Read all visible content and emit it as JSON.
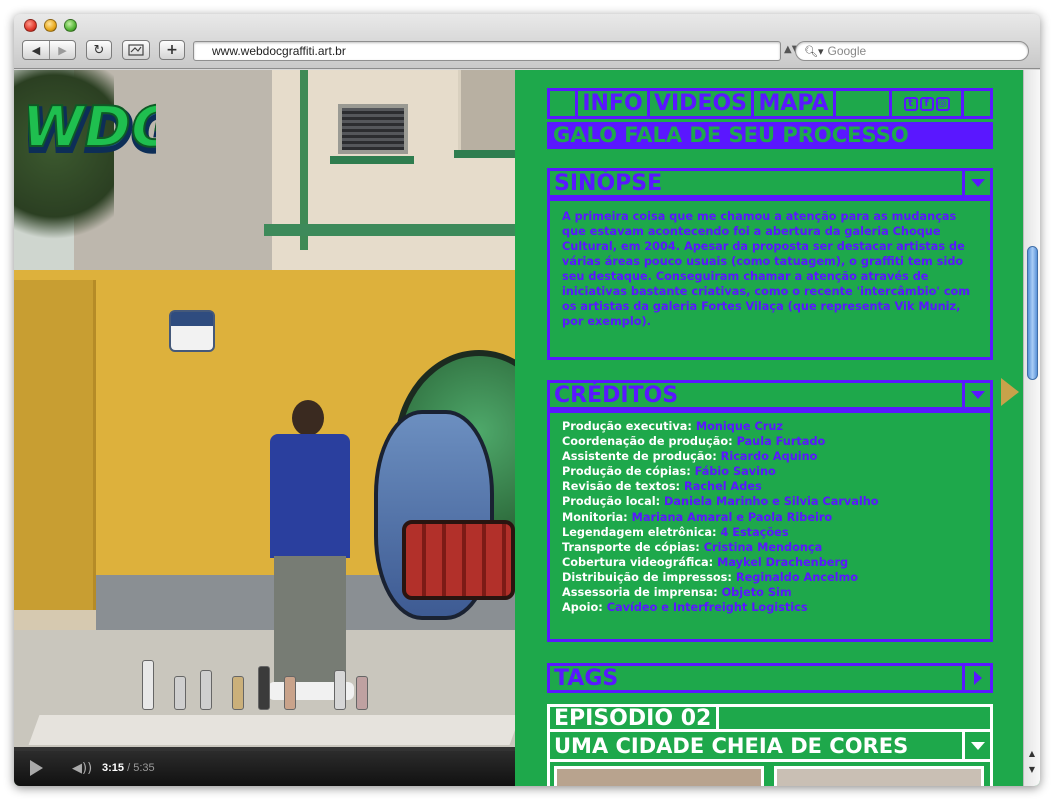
{
  "browser": {
    "url": "www.webdocgraffiti.art.br",
    "search_placeholder": "Google"
  },
  "player": {
    "current_time": "3:15",
    "separator": " / ",
    "duration": "5:35"
  },
  "site": {
    "logo_text": "WDG",
    "nav": [
      "INFO",
      "VIDEOS",
      "MAPA"
    ],
    "social": [
      {
        "icon": "twitter-icon",
        "glyph": "t"
      },
      {
        "icon": "facebook-icon",
        "glyph": "f"
      },
      {
        "icon": "instagram-icon",
        "glyph": "◎"
      }
    ],
    "video_title": "GALO FALA DE SEU PROCESSO"
  },
  "sinopse": {
    "heading": "SINÓPSE",
    "text": "A primeira coisa que me chamou a atenção para as mudanças que estavam acontecendo foi a abertura da galeria Choque Cultural, em 2004. Apesar da proposta ser destacar artistas de várias áreas pouco usuais (como tatuagem), o graffiti tem sido seu destaque. Conseguiram chamar a atenção através de iniciativas bastante criativas, como o recente 'intercâmbio' com os artistas da galeria Fortes Vilaça (que representa Vik Muniz, por exemplo)."
  },
  "creditos": {
    "heading": "CRÉDITOS",
    "items": [
      {
        "role": "Produção executiva:",
        "name": "Monique Cruz"
      },
      {
        "role": "Coordenação de produção:",
        "name": "Paula Furtado"
      },
      {
        "role": "Assistente de produção:",
        "name": "Ricardo Aquino"
      },
      {
        "role": "Produção de cópias:",
        "name": "Fábio Savino"
      },
      {
        "role": "Revisão de textos:",
        "name": "Rachel Ades"
      },
      {
        "role": "Produção local:",
        "name": "Daniela Marinho e Silvia Carvalho"
      },
      {
        "role": "Monitoria:",
        "name": "Mariana Amaral e Paola Ribeiro"
      },
      {
        "role": "Legendagem eletrônica:",
        "name": "4 Estações"
      },
      {
        "role": "Transporte de cópias:",
        "name": "Cristina Mendonça"
      },
      {
        "role": "Cobertura videográfica:",
        "name": "Maykel Drachenberg"
      },
      {
        "role": "Distribuição de impressos:",
        "name": "Reginaldo Ancelmo"
      },
      {
        "role": "Assessoria de imprensa:",
        "name": "Objeto Sim"
      },
      {
        "role": "Apoio:",
        "name": "Cavídeo e Interfreight Logistics"
      }
    ]
  },
  "tags": {
    "heading": "TAGS"
  },
  "episode": {
    "label": "EPISÓDIO 02",
    "title": "UMA CIDADE CHEIA DE CORES"
  },
  "colors": {
    "panel_green": "#1ea84b",
    "accent_purple": "#5a17ff",
    "episode_white": "#ffffff"
  }
}
